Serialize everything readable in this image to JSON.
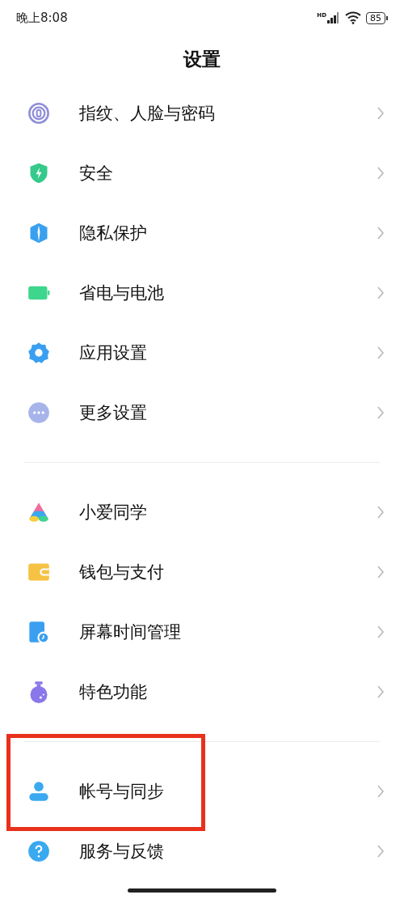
{
  "status_bar": {
    "time": "晚上8:08",
    "network": "HD",
    "battery": "85"
  },
  "title": "设置",
  "groups": [
    {
      "items": [
        {
          "label": "指纹、人脸与密码",
          "highlighted": false
        },
        {
          "label": "安全",
          "highlighted": false
        },
        {
          "label": "隐私保护",
          "highlighted": false
        },
        {
          "label": "省电与电池",
          "highlighted": false
        },
        {
          "label": "应用设置",
          "highlighted": false
        },
        {
          "label": "更多设置",
          "highlighted": false
        }
      ]
    },
    {
      "items": [
        {
          "label": "小爱同学",
          "highlighted": false
        },
        {
          "label": "钱包与支付",
          "highlighted": false
        },
        {
          "label": "屏幕时间管理",
          "highlighted": false
        },
        {
          "label": "特色功能",
          "highlighted": false
        }
      ]
    },
    {
      "items": [
        {
          "label": "帐号与同步",
          "highlighted": true
        },
        {
          "label": "服务与反馈",
          "highlighted": false
        }
      ]
    }
  ]
}
